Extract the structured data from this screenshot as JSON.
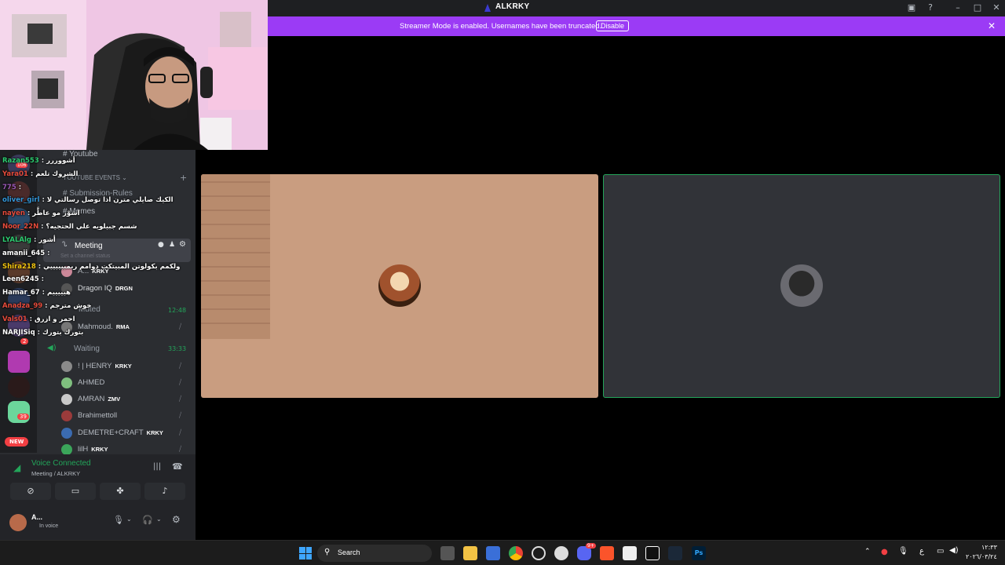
{
  "window": {
    "title": "ALKRKY"
  },
  "banner": {
    "message": "Streamer Mode is enabled. Usernames have been truncated.",
    "button": "Disable"
  },
  "channels": {
    "youtube": "Youtube",
    "category": "YOUTUBE EVENTS",
    "submission": "Submission-Rules",
    "memes": "Memes",
    "meeting": "Meeting",
    "meeting_status": "Set a channel status",
    "muted": "Muted",
    "muted_time": "12:48",
    "waiting": "Waiting",
    "waiting_time": "33:33"
  },
  "meeting_users": [
    {
      "name": "A...",
      "tag": "KRKY"
    },
    {
      "name": "Dragon IQ",
      "tag": "DRGN"
    },
    {
      "name": "Mahmoud.",
      "tag": "RMA"
    }
  ],
  "waiting_users": [
    {
      "name": "! | HENRY",
      "tag": "KRKY",
      "color": "#8a8a8a"
    },
    {
      "name": "AHMED",
      "tag": "",
      "color": "#7fbf7f"
    },
    {
      "name": "AMRAN",
      "tag": "ZMV",
      "color": "#c9c9c9"
    },
    {
      "name": "Brahimettoll",
      "tag": "",
      "color": "#9b3b3b"
    },
    {
      "name": "DEMETRE+CRAFT",
      "tag": "KRKY",
      "color": "#3b6bb0"
    },
    {
      "name": "lilH",
      "tag": "KRKY",
      "color": "#3ba55a"
    }
  ],
  "chat": [
    {
      "user": "Razan553",
      "msg": "أشووررر",
      "color": "#2ecc71"
    },
    {
      "user": "Yara01",
      "msg": "الشروك تلعم",
      "color": "#e74c3c"
    },
    {
      "user": "775",
      "msg": "",
      "color": "#9b59b6"
    },
    {
      "user": "oliver_girl",
      "msg": "الكيك صايلي مترن اذا توصل رسالتي لا",
      "color": "#3498db"
    },
    {
      "user": "nayen",
      "msg": "اشوْر مو عاطَّر",
      "color": "#e74c3c"
    },
    {
      "user": "Noor_22N",
      "msg": "شسم جبيلويه علي الحتجيه؟",
      "color": "#e74c3c"
    },
    {
      "user": "LYALAlg",
      "msg": "أشور",
      "color": "#2ecc71"
    },
    {
      "user": "amanii_645",
      "msg": "",
      "color": "#ffffff"
    },
    {
      "user": "Shira218",
      "msg": "ولكمم بكولوتن المبيتكت دوامم ربمبيييييي",
      "color": "#f1c40f"
    },
    {
      "user": "Leen6245",
      "msg": "",
      "color": "#ffffff"
    },
    {
      "user": "Hamar_67",
      "msg": "هيييييم",
      "color": "#ffffff"
    },
    {
      "user": "Anadza_99",
      "msg": "خوش مترجم",
      "color": "#e74c3c"
    },
    {
      "user": "Vals01",
      "msg": "احمر و ازرق",
      "color": "#e74c3c"
    },
    {
      "user": "NARJISiq",
      "msg": "بتورك بتورك",
      "color": "#ffffff"
    }
  ],
  "guild_badges": {
    "new": "NEW",
    "count": "39",
    "count2": "2",
    "count3": "106"
  },
  "voice": {
    "status": "Voice Connected",
    "location": "Meeting / ALKRKY"
  },
  "user": {
    "name": "A...",
    "status": "In voice"
  },
  "taskbar": {
    "search_placeholder": "Search",
    "discord_badge": "9+",
    "clock_time": "١٢:٣٣",
    "clock_date": "٢٠٢٦/٠٣/٢٤",
    "lang": "ع"
  }
}
